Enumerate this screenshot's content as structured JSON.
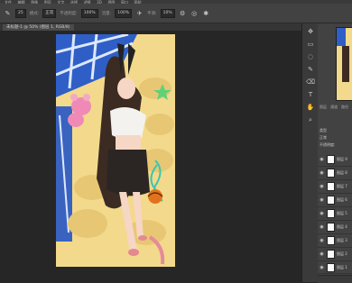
{
  "menubar": {
    "items": [
      "文件",
      "编辑",
      "图像",
      "图层",
      "文字",
      "选择",
      "滤镜",
      "3D",
      "视图",
      "窗口",
      "帮助"
    ]
  },
  "options": {
    "brush_size": "25",
    "mode_label": "模式:",
    "mode_value": "正常",
    "opacity_label": "不透明度:",
    "opacity_value": "100%",
    "flow_label": "流量:",
    "flow_value": "100%",
    "smooth_label": "平滑:",
    "smooth_value": "10%"
  },
  "document": {
    "tab_label": "未标题-1 @ 50% (图层 1, RGB/8)"
  },
  "panel": {
    "tabs": [
      "图层",
      "通道",
      "路径"
    ],
    "kind_label": "类型",
    "blend_mode": "正常",
    "opacity_label": "不透明度:",
    "layers": [
      {
        "name": "图层 9"
      },
      {
        "name": "图层 8"
      },
      {
        "name": "图层 7"
      },
      {
        "name": "图层 6"
      },
      {
        "name": "图层 5"
      },
      {
        "name": "图层 4"
      },
      {
        "name": "图层 3"
      },
      {
        "name": "图层 2"
      },
      {
        "name": "图层 1"
      }
    ]
  },
  "icons": {
    "move": "move-icon",
    "marquee": "marquee-icon",
    "lasso": "lasso-icon",
    "brush": "brush-icon",
    "eraser": "eraser-icon",
    "eye": "eye-icon"
  },
  "colors": {
    "canvas_blue": "#2f5fc6",
    "pillow_yellow": "#f2d98a",
    "skirt": "#2b2624",
    "hair": "#3b2b22"
  }
}
